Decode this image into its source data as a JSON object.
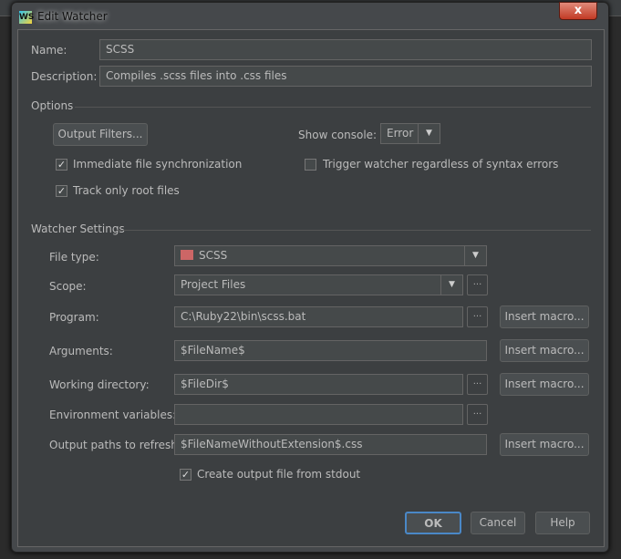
{
  "window": {
    "title": "Edit Watcher",
    "close": "x",
    "logo": "WS"
  },
  "name": {
    "label": "Name:",
    "value": "SCSS"
  },
  "description": {
    "label": "Description:",
    "value": "Compiles .scss files into .css files"
  },
  "options": {
    "header": "Options",
    "output_filters": "Output Filters...",
    "show_console_label": "Show console:",
    "show_console_value": "Error",
    "immediate_sync": {
      "label": "Immediate file synchronization",
      "checked": true
    },
    "trigger_regardless": {
      "label": "Trigger watcher regardless of syntax errors",
      "checked": false
    },
    "track_root": {
      "label": "Track only root files",
      "checked": true
    }
  },
  "watcher": {
    "header": "Watcher Settings",
    "file_type": {
      "label": "File type:",
      "value": "SCSS",
      "icon": "scss-file-icon"
    },
    "scope": {
      "label": "Scope:",
      "value": "Project Files"
    },
    "program": {
      "label": "Program:",
      "value": "C:\\Ruby22\\bin\\scss.bat"
    },
    "arguments": {
      "label": "Arguments:",
      "value": "$FileName$"
    },
    "working_dir": {
      "label": "Working directory:",
      "value": "$FileDir$"
    },
    "env": {
      "label": "Environment variables:",
      "value": ""
    },
    "output_paths": {
      "label": "Output paths to refresh:",
      "value": "$FileNameWithoutExtension$.css"
    },
    "create_output": {
      "label": "Create output file from stdout",
      "checked": true
    },
    "insert_macro": "Insert macro...",
    "browse": "..."
  },
  "buttons": {
    "ok": "OK",
    "cancel": "Cancel",
    "help": "Help"
  }
}
